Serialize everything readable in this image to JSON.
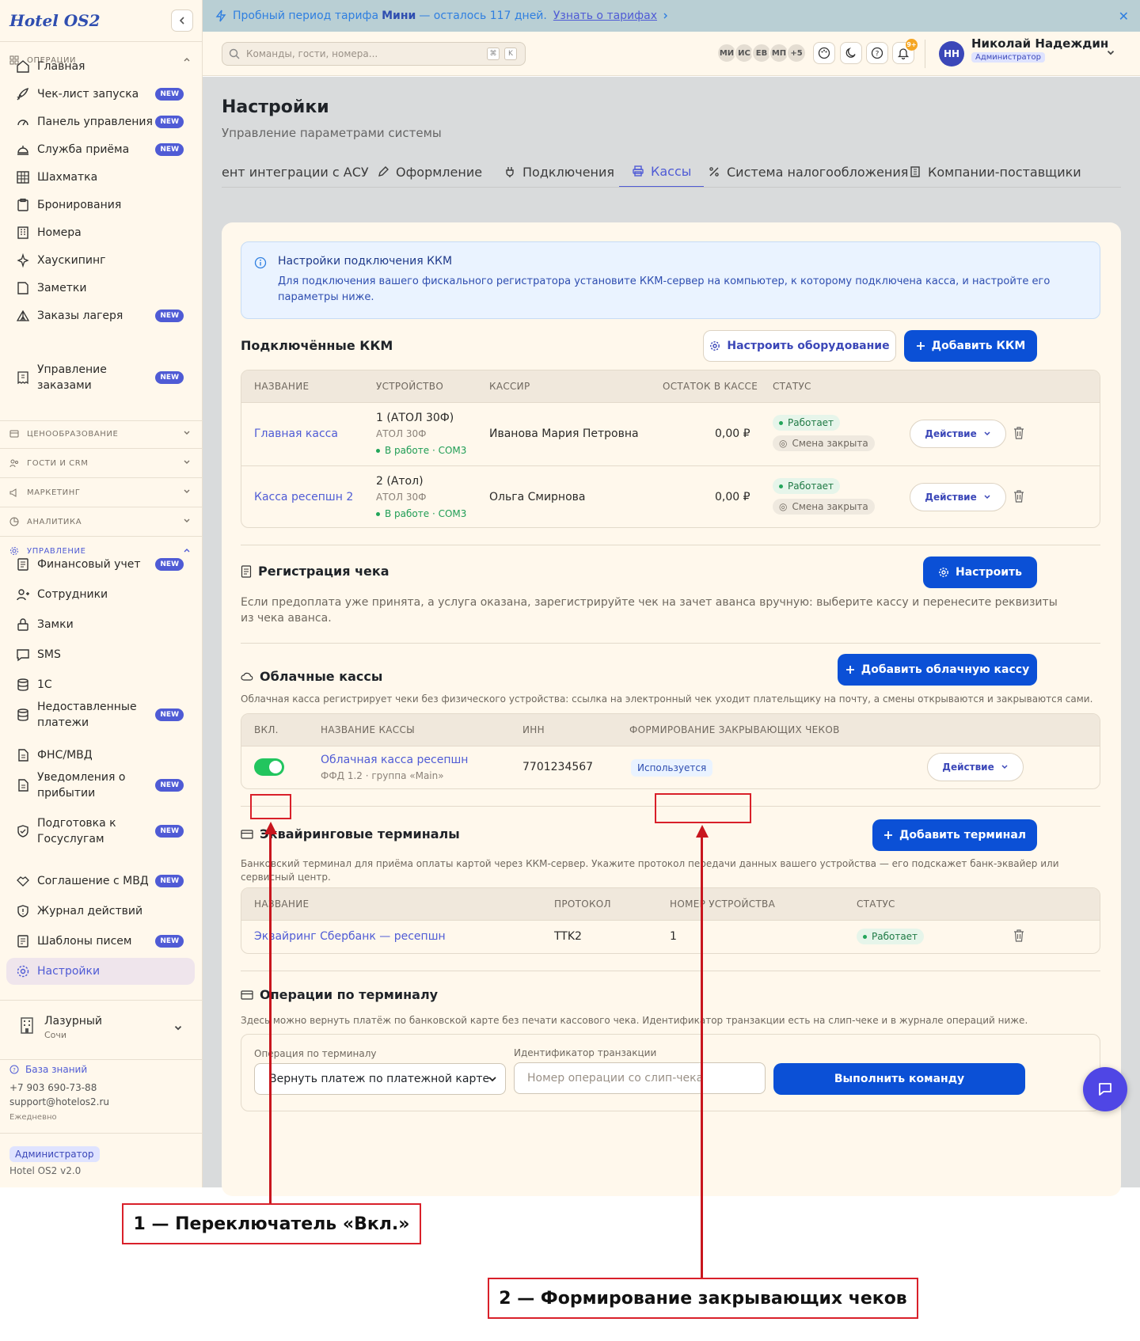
{
  "app": {
    "logo": "Hotel OS2"
  },
  "banner": {
    "prefix": "Пробный период тарифа",
    "plan": "Мини",
    "rest": "— осталось 117 дней.",
    "link": "Узнать о тарифах"
  },
  "search": {
    "placeholder": "Команды, гости, номера...",
    "kbd1": "⌘",
    "kbd2": "K"
  },
  "avatars": [
    "МИ",
    "ИС",
    "ЕВ",
    "МП",
    "+5"
  ],
  "notifications": {
    "count": "9+"
  },
  "user": {
    "initials": "НН",
    "name": "Николай Надеждин",
    "role": "Администратор"
  },
  "sidebar": {
    "groups": {
      "operations": "ОПЕРАЦИИ",
      "pricing": "ЦЕНООБРАЗОВАНИЕ",
      "guests": "ГОСТИ И CRM",
      "marketing": "МАРКЕТИНГ",
      "analytics": "АНАЛИТИКА",
      "management": "УПРАВЛЕНИЕ"
    },
    "new_label": "NEW",
    "ops": [
      {
        "label": "Главная"
      },
      {
        "label": "Чек-лист запуска"
      },
      {
        "label": "Панель управления"
      },
      {
        "label": "Служба приёма"
      },
      {
        "label": "Шахматка"
      },
      {
        "label": "Бронирования"
      },
      {
        "label": "Номера"
      },
      {
        "label": "Хаускипинг"
      },
      {
        "label": "Заметки"
      },
      {
        "label": "Заказы лагеря"
      },
      {
        "label": "Управление заказами"
      }
    ],
    "mgmt": [
      {
        "label": "Финансовый учет"
      },
      {
        "label": "Сотрудники"
      },
      {
        "label": "Замки"
      },
      {
        "label": "SMS"
      },
      {
        "label": "1С"
      },
      {
        "label": "Недоставленные платежи"
      },
      {
        "label": "ФНС/МВД"
      },
      {
        "label": "Уведомления о прибытии"
      },
      {
        "label": "Подготовка к Госуслугам"
      },
      {
        "label": "Соглашение с МВД"
      },
      {
        "label": "Журнал действий"
      },
      {
        "label": "Шаблоны писем"
      },
      {
        "label": "Настройки"
      }
    ],
    "hotel": {
      "name": "Лазурный",
      "city": "Сочи"
    },
    "knowledge": "База знаний",
    "phone": "+7 903 690-73-88",
    "email": "support@hotelos2.ru",
    "hours": "Ежедневно",
    "role": "Администратор",
    "version": "Hotel OS2 v2.0"
  },
  "page": {
    "title": "Настройки",
    "subtitle": "Управление параметрами системы"
  },
  "tabs": [
    "ент интеграции с АСУ",
    "Оформление",
    "Подключения",
    "Кассы",
    "Система налогообложения",
    "Компании-поставщики"
  ],
  "info": {
    "title": "Настройки подключения ККМ",
    "text": "Для подключения вашего фискального регистратора установите ККМ-сервер на компьютер, к которому подключена касса, и настройте его параметры ниже."
  },
  "kkm": {
    "title": "Подключённые ККМ",
    "configure_btn": "Настроить оборудование",
    "add_btn": "Добавить ККМ",
    "headers": [
      "НАЗВАНИЕ",
      "УСТРОЙСТВО",
      "КАССИР",
      "ОСТАТОК В КАССЕ",
      "СТАТУС"
    ],
    "rows": [
      {
        "name": "Главная касса",
        "device": "1 (АТОЛ 30Ф)",
        "model": "АТОЛ 30Ф",
        "state": "В работе · COM3",
        "cashier": "Иванова Мария Петровна",
        "balance": "0,00 ₽",
        "status": "Работает",
        "shift": "Смена закрыта",
        "action": "Действие"
      },
      {
        "name": "Касса ресепшн 2",
        "device": "2 (Атол)",
        "model": "АТОЛ 30Ф",
        "state": "В работе · COM3",
        "cashier": "Ольга Смирнова",
        "balance": "0,00 ₽",
        "status": "Работает",
        "shift": "Смена закрыта",
        "action": "Действие"
      }
    ]
  },
  "receipt": {
    "title": "Регистрация чека",
    "button": "Настроить",
    "text": "Если предоплата уже принята, а услуга оказана, зарегистрируйте чек на зачет аванса вручную: выберите кассу и перенесите реквизиты из чека аванса."
  },
  "cloud": {
    "title": "Облачные кассы",
    "add_btn": "Добавить облачную кассу",
    "text": "Облачная касса регистрирует чеки без физического устройства: ссылка на электронный чек уходит плательщику на почту, а смены открываются и закрываются сами.",
    "headers": [
      "ВКЛ.",
      "НАЗВАНИЕ КАССЫ",
      "ИНН",
      "ФОРМИРОВАНИЕ ЗАКРЫВАЮЩИХ ЧЕКОВ"
    ],
    "row": {
      "enabled": true,
      "name": "Облачная касса ресепшн",
      "meta": "ФФД 1.2 · группа «Main»",
      "inn": "7701234567",
      "closing": "Используется",
      "action": "Действие"
    }
  },
  "acquiring": {
    "title": "Эквайринговые терминалы",
    "add_btn": "Добавить терминал",
    "text": "Банковский терминал для приёма оплаты картой через ККМ-сервер. Укажите протокол передачи данных вашего устройства — его подскажет банк-эквайер или сервисный центр.",
    "headers": [
      "НАЗВАНИЕ",
      "ПРОТОКОЛ",
      "НОМЕР УСТРОЙСТВА",
      "СТАТУС"
    ],
    "row": {
      "name": "Эквайринг Сбербанк — ресепшн",
      "protocol": "TTK2",
      "device_no": "1",
      "status": "Работает"
    }
  },
  "terminal_ops": {
    "title": "Операции по терминалу",
    "text": "Здесь можно вернуть платёж по банковской карте без печати кассового чека. Идентификатор транзакции есть на слип-чеке и в журнале операций ниже.",
    "op_label": "Операция по терминалу",
    "op_value": "Вернуть платеж по платежной карте",
    "tx_label": "Идентификатор транзакции",
    "tx_placeholder": "Номер операции со слип-чека",
    "run_btn": "Выполнить команду"
  },
  "annotations": {
    "one": "1 — Переключатель «Вкл.»",
    "two": "2 — Формирование закрывающих чеков"
  },
  "colors": {
    "accent": "#4f5bd5",
    "primary_button": "#0b50d6",
    "success": "#22c55e",
    "annotation": "#d9202a",
    "sidebar_bg": "#fff8ec"
  }
}
